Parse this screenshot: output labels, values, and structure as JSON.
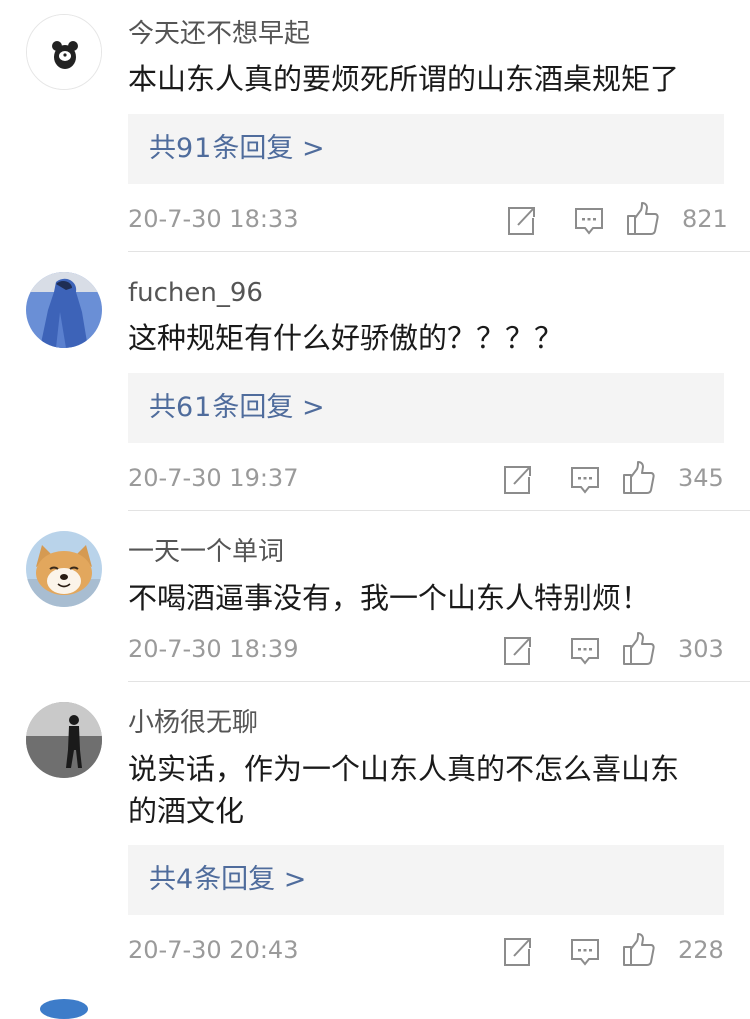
{
  "comments": [
    {
      "username": "今天还不想早起",
      "content": "本山东人真的要烦死所谓的山东酒桌规矩了",
      "replies": {
        "prefix": "共",
        "count": "91",
        "suffix": "条回复 >"
      },
      "time": "20-7-30 18:33",
      "likes": "821",
      "avatar_icon": "bear-avatar-icon"
    },
    {
      "username": "fuchen_96",
      "content": "这种规矩有什么好骄傲的？？？？",
      "replies": {
        "prefix": "共",
        "count": "61",
        "suffix": "条回复 >"
      },
      "time": "20-7-30 19:37",
      "likes": "345",
      "avatar_icon": "blue-figure-avatar-icon"
    },
    {
      "username": "一天一个单词",
      "content": "不喝酒逼事没有，我一个山东人特别烦！",
      "time": "20-7-30 18:39",
      "likes": "303",
      "avatar_icon": "shiba-dog-avatar-icon"
    },
    {
      "username": "小杨很无聊",
      "content_lines": [
        "说实话，作为一个山东人真的不怎么喜山东",
        "的酒文化"
      ],
      "replies": {
        "prefix": "共",
        "count": "4",
        "suffix": "条回复 >"
      },
      "time": "20-7-30 20:43",
      "likes": "228",
      "avatar_icon": "person-standing-avatar-icon"
    }
  ],
  "icons": {
    "share": "share-icon",
    "comment": "comment-icon",
    "like": "thumbs-up-icon"
  },
  "colors": {
    "link": "#4f6c9c",
    "meta": "#9a9a9a",
    "reply_bg": "#f4f4f4"
  }
}
